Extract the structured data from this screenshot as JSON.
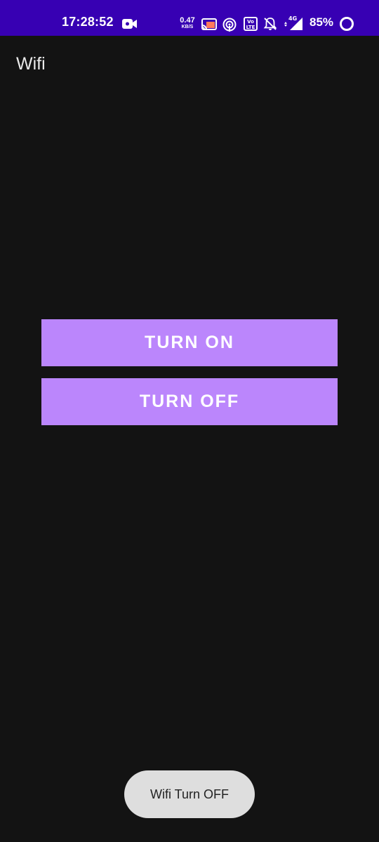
{
  "status_bar": {
    "time": "17:28:52",
    "net_speed_value": "0.47",
    "net_speed_unit": "KB/S",
    "volte_label": "Vo LTE",
    "network_type": "4G",
    "battery_percent": "85%",
    "icons": [
      "video-camera-icon",
      "cast-icon",
      "hotspot-icon",
      "volte-icon",
      "notifications-off-icon",
      "signal-icon",
      "battery-circle-icon"
    ],
    "background_color": "#3700b3"
  },
  "app_bar": {
    "title": "Wifi"
  },
  "main": {
    "turn_on_label": "TURN ON",
    "turn_off_label": "TURN OFF",
    "button_color": "#bb86fc"
  },
  "toast": {
    "message": "Wifi Turn OFF"
  }
}
